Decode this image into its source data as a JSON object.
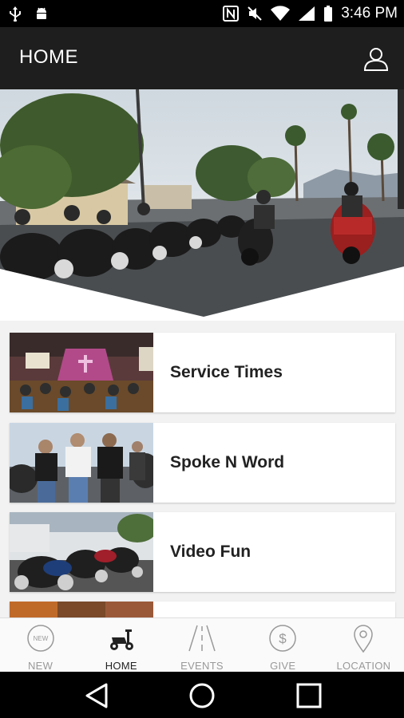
{
  "status_bar": {
    "time": "3:46 PM",
    "icons": [
      "usb-icon",
      "android-debug-icon",
      "nfc-icon",
      "mute-icon",
      "wifi-icon",
      "signal-icon",
      "battery-icon"
    ]
  },
  "app_bar": {
    "title": "HOME",
    "user_icon": "user-icon"
  },
  "cards": [
    {
      "label": "Service Times"
    },
    {
      "label": "Spoke N Word"
    },
    {
      "label": "Video Fun"
    },
    {
      "label": ""
    }
  ],
  "bottom_nav": [
    {
      "label": "NEW",
      "icon": "new-badge-icon",
      "active": false
    },
    {
      "label": "HOME",
      "icon": "scooter-icon",
      "active": true
    },
    {
      "label": "EVENTS",
      "icon": "road-icon",
      "active": false
    },
    {
      "label": "GIVE",
      "icon": "dollar-icon",
      "active": false
    },
    {
      "label": "LOCATION",
      "icon": "map-pin-icon",
      "active": false
    }
  ],
  "new_badge_text": "NEW",
  "colors": {
    "app_bar": "#1e1e1e",
    "status_bar": "#000000",
    "background": "#f2f2f2",
    "active_nav": "#222222",
    "inactive_nav": "#999999"
  }
}
